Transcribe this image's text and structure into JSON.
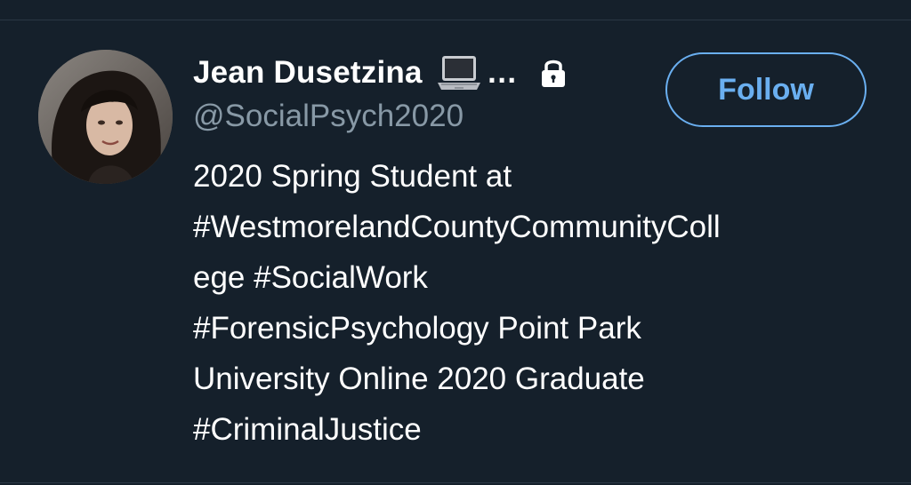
{
  "user": {
    "display_name": "Jean Dusetzina",
    "name_emoji_icon": "laptop-icon",
    "truncation": "…",
    "protected_icon": "lock-icon",
    "handle": "@SocialPsych2020",
    "bio_lines": [
      "2020 Spring Student at",
      "#WestmorelandCountyCommunityColl",
      "ege #SocialWork",
      "#ForensicPsychology Point Park",
      "University Online 2020 Graduate",
      "#CriminalJustice"
    ]
  },
  "actions": {
    "follow_label": "Follow"
  },
  "colors": {
    "background": "#15202b",
    "text_primary": "#ffffff",
    "text_secondary": "#8899a6",
    "accent": "#6aaff0",
    "divider": "#2a3744"
  }
}
